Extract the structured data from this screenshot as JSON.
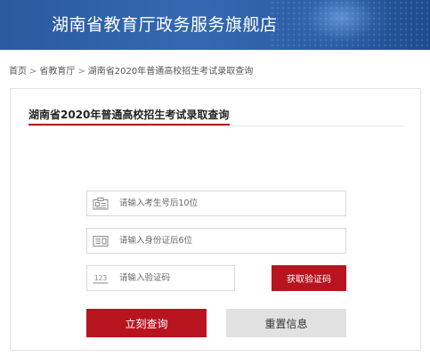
{
  "header": {
    "title": "湖南省教育厅政务服务旗舰店"
  },
  "breadcrumb": {
    "items": [
      "首页",
      "省教育厅",
      "湖南省2020年普通高校招生考试录取查询"
    ],
    "separator": ">"
  },
  "panel": {
    "title": "湖南省2020年普通高校招生考试录取查询"
  },
  "form": {
    "exam_number": {
      "placeholder": "请输入考生号后10位",
      "value": "",
      "icon": "id-card-icon"
    },
    "id_number": {
      "placeholder": "请输入身份证后6位",
      "value": "",
      "icon": "id-document-icon"
    },
    "verify_code": {
      "placeholder": "请输入验证码",
      "value": "",
      "icon": "code-123-icon",
      "icon_text": "123"
    },
    "get_code_label": "获取验证码",
    "submit_label": "立刻查询",
    "reset_label": "重置信息"
  },
  "colors": {
    "banner": "#3568b0",
    "accent_red": "#b8141f",
    "reset_gray": "#e1e1e1"
  }
}
